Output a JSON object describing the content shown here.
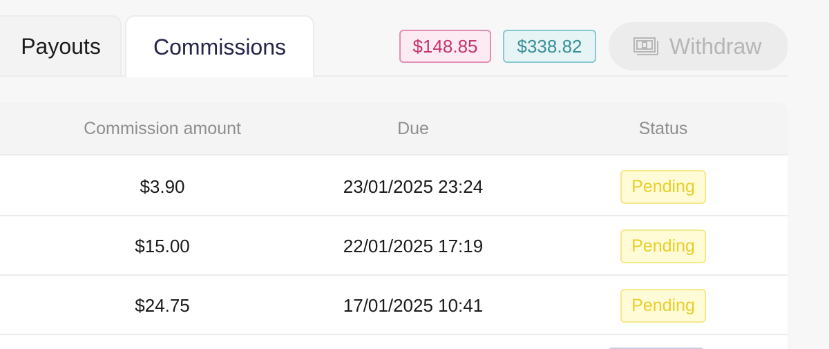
{
  "tabs": {
    "payouts_label": "Payouts",
    "commissions_label": "Commissions",
    "active": "Commissions"
  },
  "balances": {
    "pending_amount": "$148.85",
    "available_amount": "$338.82"
  },
  "withdraw": {
    "label": "Withdraw",
    "icon": "banknote-icon",
    "disabled": true
  },
  "table": {
    "headers": {
      "amount": "Commission amount",
      "due": "Due",
      "status": "Status"
    },
    "rows": [
      {
        "amount": "$3.90",
        "due": "23/01/2025 23:24",
        "status": "Pending"
      },
      {
        "amount": "$15.00",
        "due": "22/01/2025 17:19",
        "status": "Pending"
      },
      {
        "amount": "$24.75",
        "due": "17/01/2025 10:41",
        "status": "Pending"
      }
    ]
  },
  "colors": {
    "pending_badge": "#fffbd6",
    "pink_balance": "#c6336f",
    "teal_balance": "#3a8f97"
  }
}
